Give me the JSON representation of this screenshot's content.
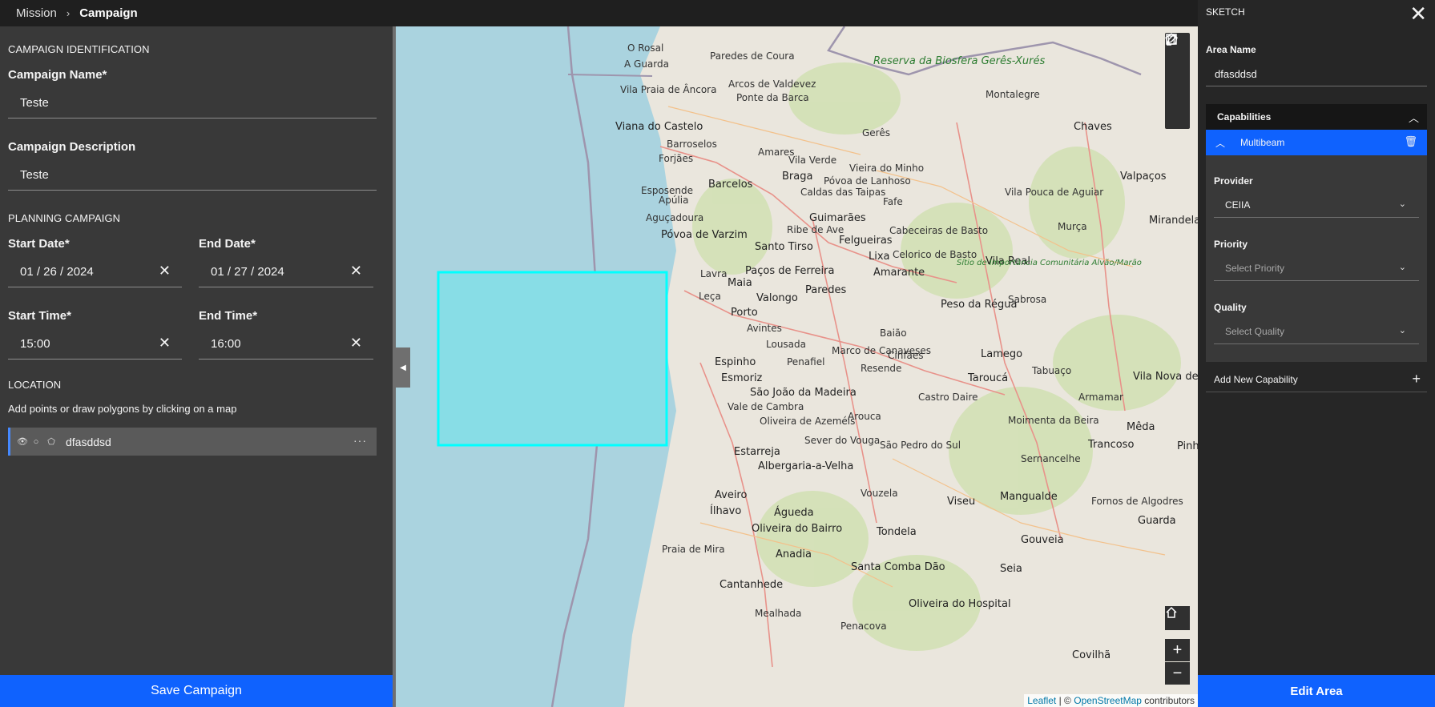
{
  "breadcrumb": {
    "parent": "Mission",
    "separator": "›",
    "current": "Campaign"
  },
  "left": {
    "identification_title": "CAMPAIGN IDENTIFICATION",
    "campaign_name_label": "Campaign Name*",
    "campaign_name_value": "Teste",
    "campaign_desc_label": "Campaign Description",
    "campaign_desc_value": "Teste",
    "planning_title": "PLANNING CAMPAIGN",
    "start_date_label": "Start Date*",
    "start_date_value": "01 / 26 / 2024",
    "end_date_label": "End Date*",
    "end_date_value": "01 / 27 / 2024",
    "start_time_label": "Start Time*",
    "start_time_value": "15:00",
    "end_time_label": "End Time*",
    "end_time_value": "16:00",
    "clear_glyph": "✕",
    "location_title": "LOCATION",
    "location_hint": "Add points or draw polygons by clicking on a map",
    "location_item": {
      "name": "dfasddsd",
      "menu": "···"
    },
    "save_label": "Save Campaign"
  },
  "map": {
    "places": [
      "O Rosal",
      "A Guarda",
      "Paredes de Coura",
      "Arcos de Valdevez",
      "Ponte da Barca",
      "Vila Praia de Âncora",
      "Viana do Castelo",
      "Barroselos",
      "Forjães",
      "Barcelos",
      "Esposende",
      "Apúlia",
      "Aguçadoura",
      "Póvoa de Varzim",
      "Braga",
      "Vila Verde",
      "Guimarães",
      "Caldas das Taipas",
      "Ribe de Ave",
      "Santo Tirso",
      "Felgueiras",
      "Lixa",
      "Amarante",
      "Paços de Ferreira",
      "Paredes",
      "Valongo",
      "Maia",
      "Lavra",
      "Porto",
      "Leça",
      "Avintes",
      "Espinho",
      "Esmoriz",
      "São João da Madeira",
      "Oliveira de Azeméis",
      "Estarreja",
      "Albergaria-a-Velha",
      "Aveiro",
      "Ílhavo",
      "Águeda",
      "Oliveira do Bairro",
      "Anadia",
      "Cantanhede",
      "Praia de Mira",
      "Mealhada",
      "Penacova",
      "Santa Comba Dão",
      "Tondela",
      "Viseu",
      "Mangualde",
      "Castro Daire",
      "Lamego",
      "Peso da Régua",
      "Vila Real",
      "Chaves",
      "Valpaços",
      "Mirandela",
      "Vila Pouca de Aguiar",
      "Murça",
      "Sabrosa",
      "Tabuaço",
      "Taroucá",
      "Moimenta da Beira",
      "Sernancelhe",
      "Trancoso",
      "Mêda",
      "Pinhel",
      "Guarda",
      "Gouveia",
      "Seia",
      "Oliveira do Hospital",
      "Covilhã",
      "Fornos de Algodres",
      "Vieira do Minho",
      "Montalegre",
      "Cabeceiras de Basto",
      "Celorico de Basto",
      "Gerês",
      "Amares",
      "Póvoa de Lanhoso",
      "Fafe",
      "Arouca",
      "Vale de Cambra",
      "Sever do Vouga",
      "Vouzela",
      "São Pedro do Sul",
      "Lousada",
      "Penafiel",
      "Marco de Canaveses",
      "Baião",
      "Cinfães",
      "Resende",
      "Armamar",
      "Vila Nova de Foz Côa",
      "Reserva da Biosfera Gerês-Xurés",
      "Sítio de Importância Comunitária Alvão/Marão"
    ],
    "attribution_leaflet": "Leaflet",
    "attribution_text": "| ©",
    "attribution_osm": "OpenStreetMap",
    "attribution_tail": "contributors",
    "zoom_in": "+",
    "zoom_out": "−"
  },
  "sketch": {
    "title": "SKETCH",
    "close": "✕",
    "area_name_label": "Area Name",
    "area_name_value": "dfasddsd",
    "capabilities_label": "Capabilities",
    "capability_name": "Multibeam",
    "provider_label": "Provider",
    "provider_value": "CEIIA",
    "priority_label": "Priority",
    "priority_placeholder": "Select Priority",
    "quality_label": "Quality",
    "quality_placeholder": "Select Quality",
    "add_capability": "Add New Capability",
    "add_glyph": "+",
    "edit_label": "Edit Area"
  },
  "colors": {
    "primary": "#0f62fe",
    "polygon": "#00ffff",
    "sea": "#aad3df"
  }
}
